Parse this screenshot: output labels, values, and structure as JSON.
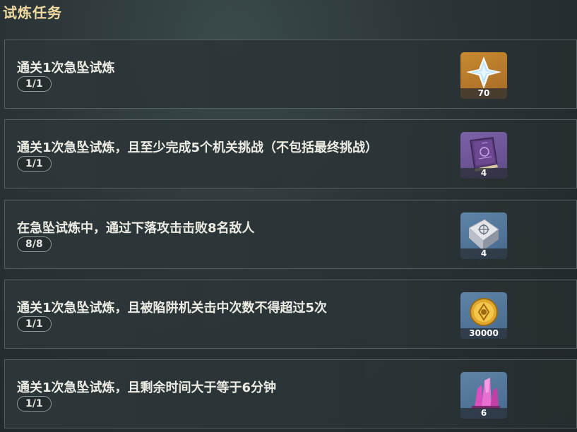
{
  "page_title": "试炼任务",
  "tasks": [
    {
      "description": "通关1次急坠试炼",
      "progress": "1/1",
      "reward": {
        "icon": "primogem-icon",
        "count": "70"
      }
    },
    {
      "description": "通关1次急坠试炼，且至少完成5个机关挑战（不包括最终挑战）",
      "progress": "1/1",
      "reward": {
        "icon": "heros-wit-book-icon",
        "count": "4"
      }
    },
    {
      "description": "在急坠试炼中，通过下落攻击击败8名敌人",
      "progress": "8/8",
      "reward": {
        "icon": "talent-book-icon",
        "count": "4"
      }
    },
    {
      "description": "通关1次急坠试炼，且被陷阱机关击中次数不得超过5次",
      "progress": "1/1",
      "reward": {
        "icon": "mora-coin-icon",
        "count": "30000"
      }
    },
    {
      "description": "通关1次急坠试炼，且剩余时间大于等于6分钟",
      "progress": "1/1",
      "reward": {
        "icon": "crystal-ore-icon",
        "count": "6"
      }
    }
  ]
}
